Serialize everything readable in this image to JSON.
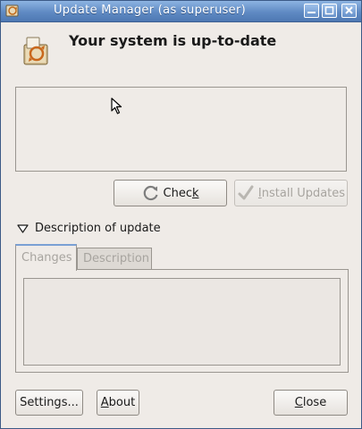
{
  "window": {
    "title": "Update Manager (as superuser)"
  },
  "status": {
    "heading": "Your system is up-to-date"
  },
  "buttons": {
    "check_pre": "Chec",
    "check_u": "k",
    "install_pre": "",
    "install_u": "I",
    "install_post": "nstall Updates",
    "settings": "Settings...",
    "about_u": "A",
    "about_post": "bout",
    "close_u": "C",
    "close_post": "lose"
  },
  "expander": {
    "label": "Description of update",
    "expanded": true
  },
  "tabs": [
    {
      "label": "Changes",
      "active": true
    },
    {
      "label": "Description",
      "active": false
    }
  ],
  "colors": {
    "titlebar": "#5f8ac3",
    "accent": "#7aa0d4",
    "disabled_text": "#a7a49f"
  },
  "icons": [
    "app-icon",
    "minimize-icon",
    "maximize-icon",
    "close-icon",
    "update-status-icon",
    "refresh-icon",
    "checkmark-icon",
    "expander-triangle-icon",
    "mouse-cursor-icon"
  ]
}
